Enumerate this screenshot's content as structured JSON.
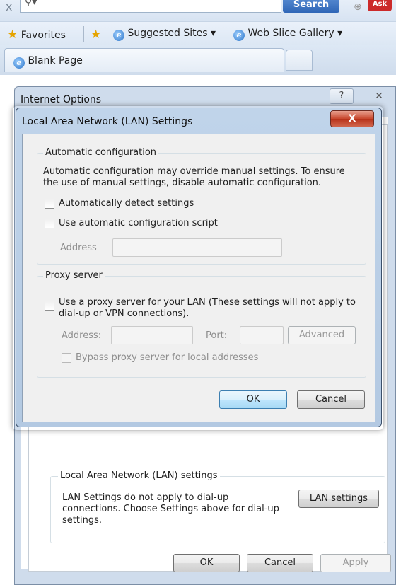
{
  "browser": {
    "search_button": "Search",
    "ask_logo": "Ask",
    "favorites_label": "Favorites",
    "suggested_sites": "Suggested Sites ▾",
    "web_slice_gallery": "Web Slice Gallery ▾",
    "tab_title": "Blank Page"
  },
  "internet_options": {
    "title": "Internet Options",
    "help_glyph": "?",
    "close_glyph": "✕",
    "lan_group": {
      "legend": "Local Area Network (LAN) settings",
      "text": "LAN Settings do not apply to dial-up connections. Choose Settings above for dial-up settings.",
      "button": "LAN settings"
    },
    "buttons": {
      "ok": "OK",
      "cancel": "Cancel",
      "apply": "Apply"
    }
  },
  "lan_dialog": {
    "title": "Local Area Network (LAN) Settings",
    "close_glyph": "X",
    "auto_config": {
      "legend": "Automatic configuration",
      "description": "Automatic configuration may override manual settings.  To ensure the use of manual settings, disable automatic configuration.",
      "detect_label": "Automatically detect settings",
      "detect_checked": false,
      "script_label": "Use automatic configuration script",
      "script_checked": false,
      "address_label": "Address",
      "address_value": ""
    },
    "proxy": {
      "legend": "Proxy server",
      "use_proxy_label": "Use a proxy server for your LAN (These settings will not apply to dial-up or VPN connections).",
      "use_proxy_checked": false,
      "address_label": "Address:",
      "address_value": "",
      "port_label": "Port:",
      "port_value": "",
      "advanced_button": "Advanced",
      "bypass_label": "Bypass proxy server for local addresses",
      "bypass_checked": false
    },
    "buttons": {
      "ok": "OK",
      "cancel": "Cancel"
    }
  }
}
